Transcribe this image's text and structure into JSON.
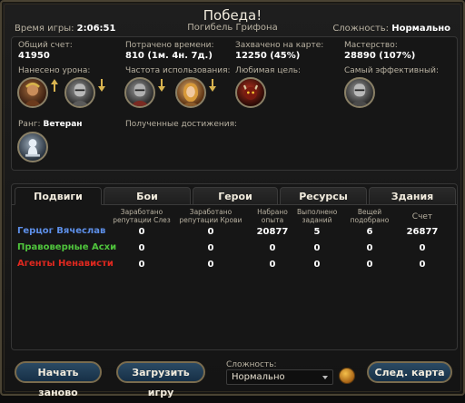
{
  "header": {
    "title": "Победа!",
    "subtitle": "Погибель Грифона",
    "time_label": "Время игры:",
    "time_value": "2:06:51",
    "difficulty_label": "Сложность:",
    "difficulty_value": "Нормально"
  },
  "summary": {
    "total_score_label": "Общий счет:",
    "total_score_value": "41950",
    "time_spent_label": "Потрачено времени:",
    "time_spent_value": "810 (1м. 4н. 7д.)",
    "captured_label": "Захвачено на карте:",
    "captured_value": "12250 (45%)",
    "mastery_label": "Мастерство:",
    "mastery_value": "28890 (107%)",
    "damage_label": "Нанесено урона:",
    "usage_label": "Частота использования:",
    "favorite_label": "Любимая цель:",
    "effective_label": "Самый эффективный:",
    "rank_label": "Ранг:",
    "rank_value": "Ветеран",
    "achievements_label": "Полученные достижения:",
    "portraits": {
      "damage_1": "warlord-portrait",
      "damage_2": "knight-portrait",
      "usage_1": "knight-portrait",
      "usage_2": "lady-portrait",
      "favorite": "demon-portrait",
      "effective": "knight-portrait",
      "rank": "veteran-rank-icon"
    }
  },
  "tabs": [
    {
      "label": "Подвиги",
      "active": true
    },
    {
      "label": "Бои",
      "active": false
    },
    {
      "label": "Герои",
      "active": false
    },
    {
      "label": "Ресурсы",
      "active": false
    },
    {
      "label": "Здания",
      "active": false
    }
  ],
  "table": {
    "columns": [
      "Заработано репутации Слез",
      "Заработано репутации Крови",
      "Набрано опыта",
      "Выполнено заданий",
      "Вещей подобрано",
      "Счет"
    ],
    "rows": [
      {
        "name": "Герцог Вячеслав",
        "color": "#5d8fe8",
        "values": [
          "0",
          "0",
          "20877",
          "5",
          "6",
          "26877"
        ]
      },
      {
        "name": "Правоверные Асхи",
        "color": "#4fc43c",
        "values": [
          "0",
          "0",
          "0",
          "0",
          "0",
          "0"
        ]
      },
      {
        "name": "Агенты Ненависти",
        "color": "#e0281f",
        "values": [
          "0",
          "0",
          "0",
          "0",
          "0",
          "0"
        ]
      }
    ]
  },
  "footer": {
    "restart_label": "Начать заново",
    "load_label": "Загрузить игру",
    "difficulty_label": "Сложность:",
    "difficulty_value": "Нормально",
    "next_map_label": "След. карта"
  }
}
